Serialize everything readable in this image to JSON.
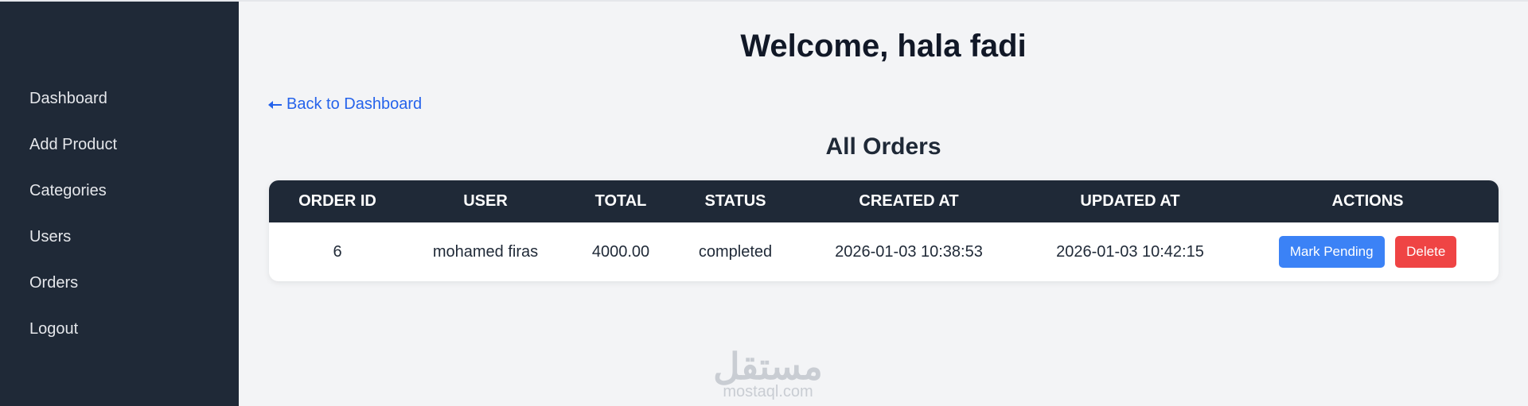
{
  "sidebar": {
    "items": [
      {
        "label": "Dashboard"
      },
      {
        "label": "Add Product"
      },
      {
        "label": "Categories"
      },
      {
        "label": "Users"
      },
      {
        "label": "Orders"
      },
      {
        "label": "Logout"
      }
    ]
  },
  "header": {
    "welcome": "Welcome, hala fadi",
    "back_link": "Back to Dashboard"
  },
  "orders": {
    "title": "All Orders",
    "columns": [
      "Order ID",
      "User",
      "Total",
      "Status",
      "Created At",
      "Updated At",
      "Actions"
    ],
    "rows": [
      {
        "order_id": "6",
        "user": "mohamed firas",
        "total": "4000.00",
        "status": "completed",
        "created_at": "2026-01-03 10:38:53",
        "updated_at": "2026-01-03 10:42:15",
        "actions": {
          "pending": "Mark Pending",
          "delete": "Delete"
        }
      }
    ]
  },
  "watermark": {
    "arabic": "مستقل",
    "domain": "mostaql.com"
  },
  "colors": {
    "sidebar_bg": "#1f2937",
    "page_bg": "#f3f4f6",
    "link": "#2563eb",
    "pending_button": "#3b82f6",
    "delete_button": "#ef4444"
  }
}
